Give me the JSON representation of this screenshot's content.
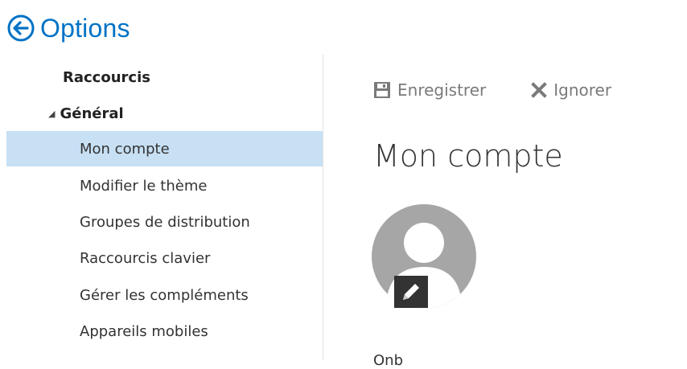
{
  "header": {
    "title": "Options",
    "back_icon": "back-arrow-circle-icon"
  },
  "sidebar": {
    "shortcuts_label": "Raccourcis",
    "general_label": "Général",
    "items": [
      {
        "label": "Mon compte",
        "selected": true
      },
      {
        "label": "Modifier le thème"
      },
      {
        "label": "Groupes de distribution"
      },
      {
        "label": "Raccourcis clavier"
      },
      {
        "label": "Gérer les compléments"
      },
      {
        "label": "Appareils mobiles"
      }
    ]
  },
  "toolbar": {
    "save_label": "Enregistrer",
    "discard_label": "Ignorer"
  },
  "main": {
    "title": "Mon compte",
    "partial_text": "Onb"
  },
  "colors": {
    "accent": "#0072c6",
    "selected_bg": "#c7e0f4"
  }
}
